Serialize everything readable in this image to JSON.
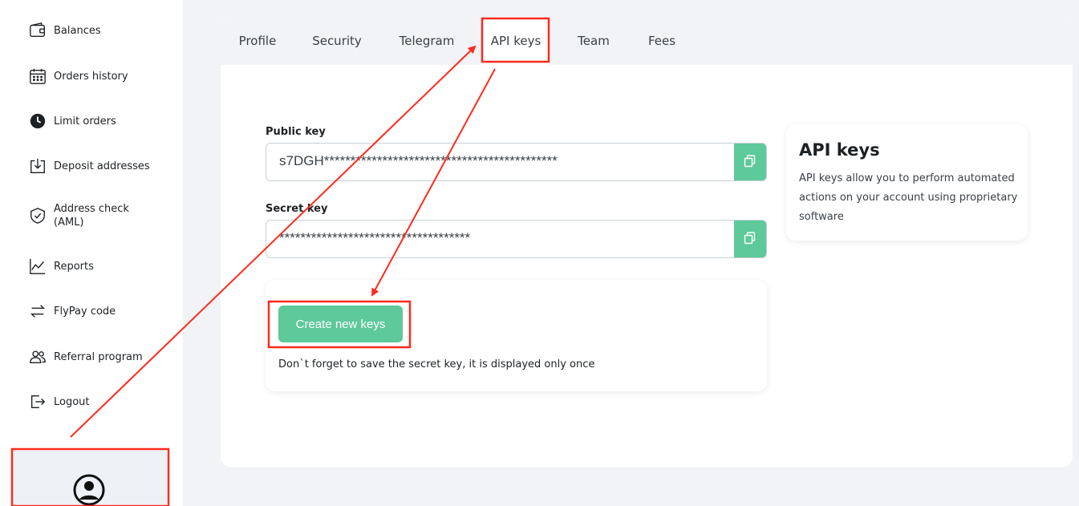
{
  "sidebar": {
    "items": [
      {
        "label": "Balances",
        "icon": "wallet-icon"
      },
      {
        "label": "Orders history",
        "icon": "calendar-icon"
      },
      {
        "label": "Limit orders",
        "icon": "clock-icon"
      },
      {
        "label": "Deposit addresses",
        "icon": "deposit-icon"
      },
      {
        "label": "Address check\n(AML)",
        "icon": "shield-icon"
      },
      {
        "label": "Reports",
        "icon": "chart-line-icon"
      },
      {
        "label": "FlyPay code",
        "icon": "swap-arrows-icon"
      },
      {
        "label": "Referral program",
        "icon": "users-icon"
      },
      {
        "label": "Logout",
        "icon": "logout-icon"
      }
    ],
    "profile_icon": "user-circle-icon"
  },
  "tabs": [
    {
      "label": "Profile"
    },
    {
      "label": "Security"
    },
    {
      "label": "Telegram"
    },
    {
      "label": "API keys",
      "active": true
    },
    {
      "label": "Team"
    },
    {
      "label": "Fees"
    }
  ],
  "public_key": {
    "label": "Public key",
    "value": "s7DGH********************************************"
  },
  "secret_key": {
    "label": "Secret key",
    "value": "************************************"
  },
  "create": {
    "button_label": "Create new keys",
    "note": "Don`t forget to save the secret key, it is displayed only once"
  },
  "info": {
    "title": "API keys",
    "text": "API keys allow you to perform automated actions on your account using proprietary software"
  },
  "colors": {
    "accent": "#5ec99a",
    "annotation": "#ff2a1f"
  }
}
